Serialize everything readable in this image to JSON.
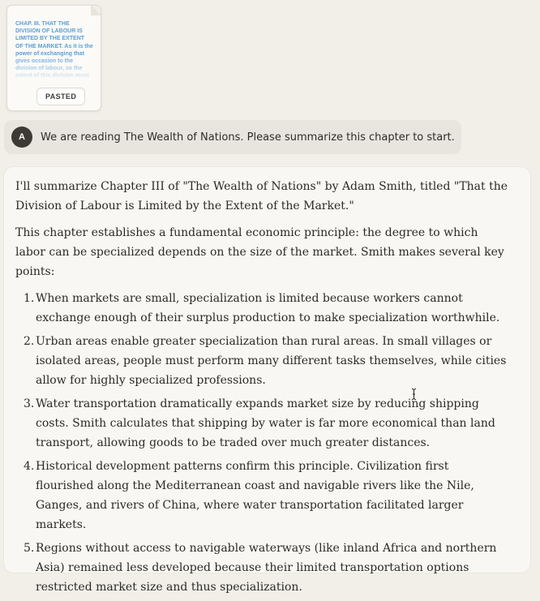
{
  "attachment": {
    "preview_text": "CHAP. III. THAT THE DIVISION OF LABOUR IS LIMITED BY THE EXTENT OF THE MARKET. As it is the power of exchanging that gives occasion to the division of labour, so the extent of this division must",
    "badge": "PASTED"
  },
  "user_message": {
    "avatar_initial": "A",
    "text": "We are reading The Wealth of Nations. Please summarize this chapter to start."
  },
  "assistant_message": {
    "intro": "I'll summarize Chapter III of \"The Wealth of Nations\" by Adam Smith, titled \"That the Division of Labour is Limited by the Extent of the Market.\"",
    "paragraph": "This chapter establishes a fundamental economic principle: the degree to which labor can be specialized depends on the size of the market. Smith makes several key points:",
    "points": [
      {
        "num": "1.",
        "text": "When markets are small, specialization is limited because workers cannot exchange enough of their surplus production to make specialization worthwhile."
      },
      {
        "num": "2.",
        "text": "Urban areas enable greater specialization than rural areas. In small villages or isolated areas, people must perform many different tasks themselves, while cities allow for highly specialized professions."
      },
      {
        "num": "3.",
        "text": "Water transportation dramatically expands market size by reducing shipping costs. Smith calculates that shipping by water is far more economical than land transport, allowing goods to be traded over much greater distances."
      },
      {
        "num": "4.",
        "text": "Historical development patterns confirm this principle. Civilization first flourished along the Mediterranean coast and navigable rivers like the Nile, Ganges, and rivers of China, where water transportation facilitated larger markets."
      },
      {
        "num": "5.",
        "text": "Regions without access to navigable waterways (like inland Africa and northern Asia) remained less developed because their limited transportation options restricted market size and thus specialization."
      }
    ]
  },
  "colors": {
    "background": "#f1efe8",
    "user_bubble": "#e7e5de",
    "assistant_bubble": "#f8f7f3",
    "preview_text": "#5a9fd8",
    "avatar": "#3d3a33"
  },
  "icons": {
    "cursor": "text-cursor-icon"
  }
}
